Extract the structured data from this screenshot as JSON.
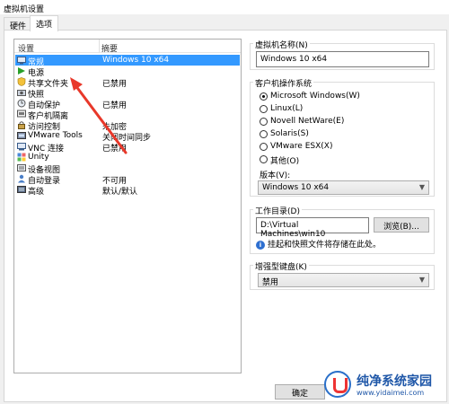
{
  "window": {
    "title": "虚拟机设置"
  },
  "tabs": [
    {
      "label": "硬件"
    },
    {
      "label": "选项"
    }
  ],
  "list": {
    "headers": {
      "setting": "设置",
      "summary": "摘要"
    },
    "rows": [
      {
        "label": "常规",
        "value": "Windows 10 x64",
        "icon": "general-icon",
        "selected": true
      },
      {
        "label": "电源",
        "value": "",
        "icon": "power-icon"
      },
      {
        "label": "共享文件夹",
        "value": "已禁用",
        "icon": "shared-folder-icon"
      },
      {
        "label": "快照",
        "value": "",
        "icon": "snapshot-icon"
      },
      {
        "label": "自动保护",
        "value": "已禁用",
        "icon": "autoprotect-icon"
      },
      {
        "label": "客户机隔离",
        "value": "",
        "icon": "isolation-icon"
      },
      {
        "label": "访问控制",
        "value": "未加密",
        "icon": "access-control-icon"
      },
      {
        "label": "VMware Tools",
        "value": "关闭时间同步",
        "icon": "vmware-tools-icon"
      },
      {
        "label": "VNC 连接",
        "value": "已禁用",
        "icon": "vnc-icon"
      },
      {
        "label": "Unity",
        "value": "",
        "icon": "unity-icon"
      },
      {
        "label": "设备视图",
        "value": "",
        "icon": "device-view-icon"
      },
      {
        "label": "自动登录",
        "value": "不可用",
        "icon": "autologin-icon"
      },
      {
        "label": "高级",
        "value": "默认/默认",
        "icon": "advanced-icon"
      }
    ]
  },
  "vm_name": {
    "label": "虚拟机名称(N)",
    "value": "Windows 10 x64"
  },
  "guest_os": {
    "label": "客户机操作系统",
    "options": [
      {
        "label": "Microsoft Windows(W)",
        "checked": true
      },
      {
        "label": "Linux(L)",
        "checked": false
      },
      {
        "label": "Novell NetWare(E)",
        "checked": false
      },
      {
        "label": "Solaris(S)",
        "checked": false
      },
      {
        "label": "VMware ESX(X)",
        "checked": false
      },
      {
        "label": "其他(O)",
        "checked": false
      }
    ],
    "version_label": "版本(V):",
    "version_value": "Windows 10 x64"
  },
  "workdir": {
    "label": "工作目录(D)",
    "value": "D:\\Virtual Machines\\win10",
    "browse_label": "浏览(B)...",
    "info": "挂起和快照文件将存储在此处。"
  },
  "keyboard": {
    "label": "增强型键盘(K)",
    "value": "禁用"
  },
  "footer": {
    "ok_label": "确定"
  },
  "watermark": {
    "title": "纯净系统家园",
    "url": "www.yidaimei.com"
  },
  "colors": {
    "selection": "#3399ff",
    "annotation_arrow": "#e8382a"
  }
}
